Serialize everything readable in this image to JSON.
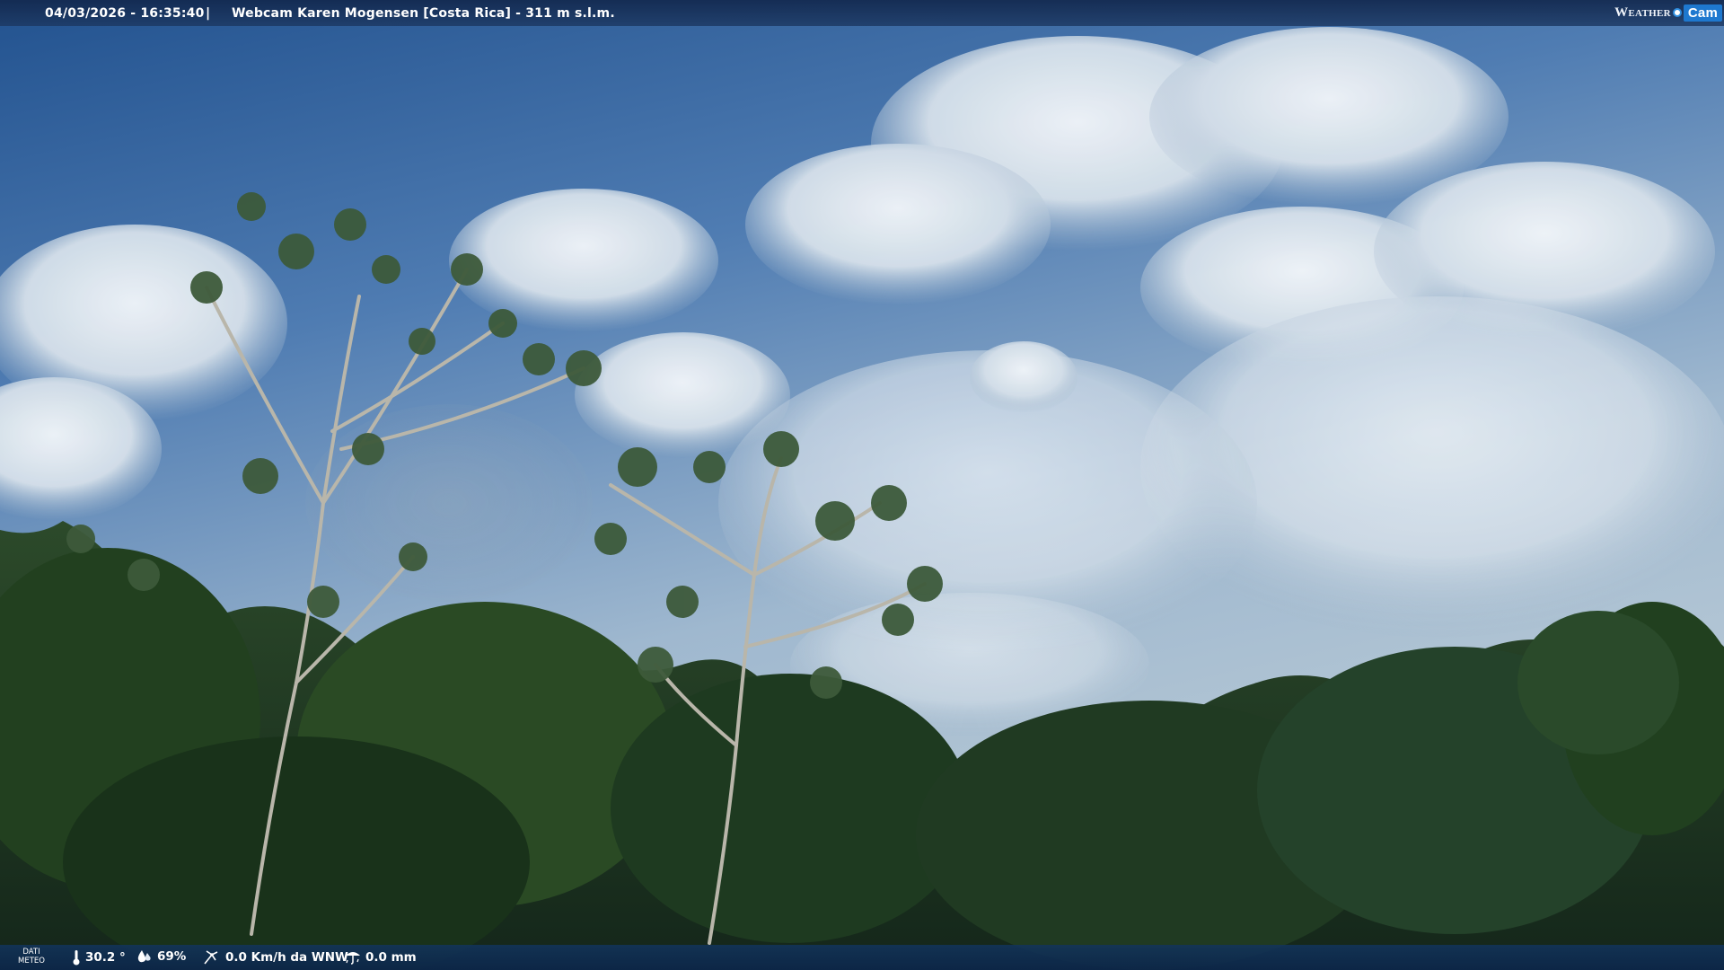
{
  "top_bar": {
    "timestamp": "04/03/2026 - 16:35:40",
    "separator": "|",
    "title": "Webcam Karen Mogensen [Costa Rica]  - 311 m s.l.m."
  },
  "brand": {
    "weather": "Weather",
    "cam": "Cam",
    "accent": "#1e78cf"
  },
  "bottom_bar": {
    "label_line1": "DATI",
    "label_line2": "METEO",
    "temperature": "30.2 °",
    "humidity": "69%",
    "wind": "0.0 Km/h da WNW",
    "rain": "0.0 mm"
  },
  "icons": [
    "thermometer-icon",
    "humidity-drop-icon",
    "wind-icon",
    "rain-icon"
  ],
  "scene": {
    "description_colors": {
      "sky_top": "#2a5b9a",
      "sky_low": "#a8bfd4",
      "forest": "#1f3a1f"
    }
  }
}
